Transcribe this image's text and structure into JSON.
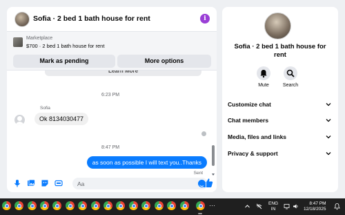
{
  "chat": {
    "title": "Sofia · 2 bed 1 bath house for rent",
    "marketplace": {
      "label": "Marketplace",
      "item": "$700 · 2 bed 1 bath house for rent",
      "pending_button": "Mark as pending",
      "more_button": "More options"
    },
    "messages": {
      "card_link": "Learn More",
      "time1": "6:23 PM",
      "sender": "Sofia",
      "incoming": "Ok 8134030477",
      "time2": "8:47 PM",
      "outgoing": "as soon as possible I will text you..Thanks",
      "status": "Sent"
    },
    "composer": {
      "placeholder": "Aa"
    }
  },
  "info_panel": {
    "title": "Sofia · 2 bed 1 bath house for rent",
    "mute_label": "Mute",
    "search_label": "Search",
    "sections": [
      "Customize chat",
      "Chat members",
      "Media, files and links",
      "Privacy & support"
    ]
  },
  "taskbar": {
    "language_top": "ENG",
    "language_bottom": "IN",
    "time": "8:47 PM",
    "date": "12/18/2025"
  },
  "colors": {
    "accent": "#0a7cff",
    "info_icon": "#9a3fd6",
    "taskbar": "#1f1f1f"
  }
}
